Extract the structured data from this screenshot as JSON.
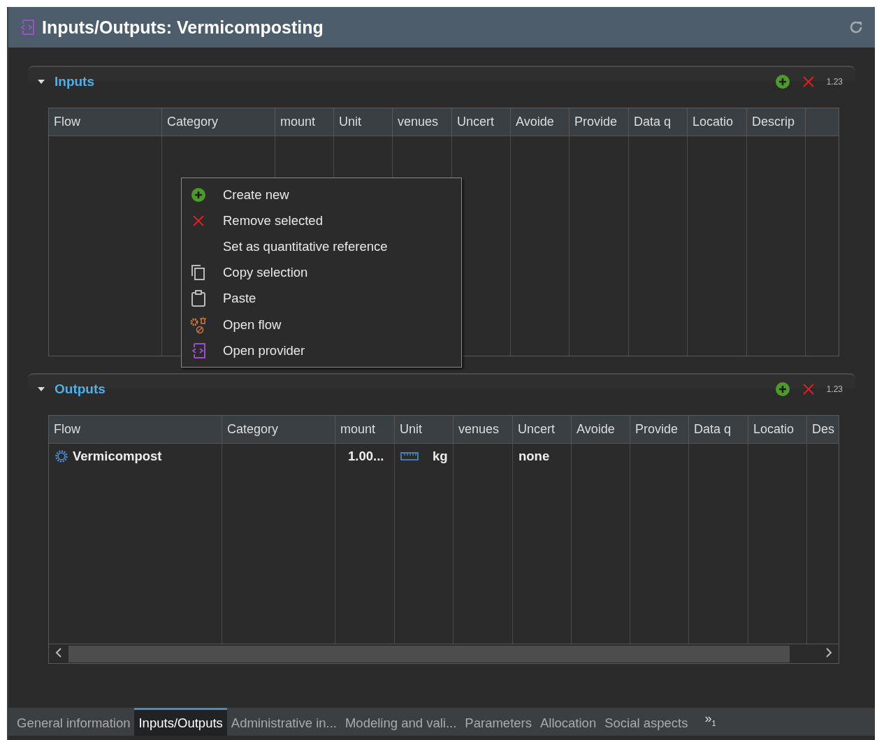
{
  "window": {
    "title": "Inputs/Outputs: Vermicomposting"
  },
  "sections": [
    {
      "title": "Inputs",
      "expanded": true,
      "toolbar_text": "1.23",
      "table": {
        "columns": [
          "Flow",
          "Category",
          "mount",
          "Unit",
          "venues",
          "Uncert",
          "Avoide",
          "Provide",
          "Data q",
          "Locatio",
          "Descrip"
        ]
      }
    },
    {
      "title": "Outputs",
      "expanded": true,
      "toolbar_text": "1.23",
      "table": {
        "columns": [
          "Flow",
          "Category",
          "mount",
          "Unit",
          "venues",
          "Uncert",
          "Avoide",
          "Provide",
          "Data q",
          "Locatio",
          "Des"
        ],
        "rows": [
          {
            "flow": "Vermicompost",
            "amount": "1.00...",
            "unit": "kg",
            "uncertainty": "none"
          }
        ]
      }
    }
  ],
  "context_menu": {
    "items": [
      {
        "label": "Create new",
        "kind": "add"
      },
      {
        "label": "Remove selected",
        "kind": "remove"
      },
      {
        "label": "Set as quantitative reference",
        "kind": "plain"
      },
      {
        "label": "Copy selection",
        "kind": "copy"
      },
      {
        "label": "Paste",
        "kind": "paste"
      },
      {
        "label": "Open flow",
        "kind": "flow"
      },
      {
        "label": "Open provider",
        "kind": "provider"
      }
    ]
  },
  "tabs": [
    {
      "label": "General information",
      "selected": false
    },
    {
      "label": "Inputs/Outputs",
      "selected": true
    },
    {
      "label": "Administrative in...",
      "selected": false
    },
    {
      "label": "Modeling and vali...",
      "selected": false
    },
    {
      "label": "Parameters",
      "selected": false
    },
    {
      "label": "Allocation",
      "selected": false
    },
    {
      "label": "Social aspects",
      "selected": false
    }
  ],
  "tab_overflow": {
    "label": "»",
    "count": "1"
  }
}
